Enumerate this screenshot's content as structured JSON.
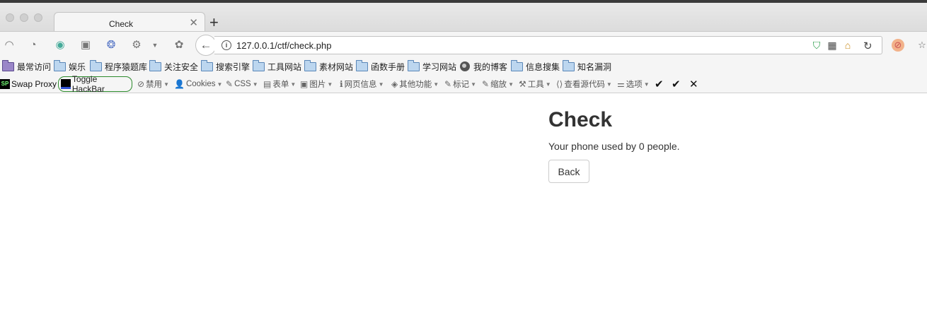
{
  "tab": {
    "title": "Check",
    "close_glyph": "✕",
    "new_tab_glyph": "+"
  },
  "nav": {
    "url": "127.0.0.1/ctf/check.php",
    "back_glyph": "←",
    "reload_glyph": "↻",
    "icons": [
      "rss-icon",
      "history-icon",
      "chrome-icon",
      "reader-icon",
      "bird-icon",
      "gear-icon",
      "palette-icon"
    ]
  },
  "bookmarks": {
    "items": [
      {
        "label": "最常访问",
        "icon": "purple-folder-icon"
      },
      {
        "label": "娱乐",
        "icon": "folder-icon"
      },
      {
        "label": "程序猿题库",
        "icon": "folder-icon"
      },
      {
        "label": "关注安全",
        "icon": "folder-icon"
      },
      {
        "label": "搜索引擎",
        "icon": "folder-icon"
      },
      {
        "label": "工具网站",
        "icon": "folder-icon"
      },
      {
        "label": "素材网站",
        "icon": "folder-icon"
      },
      {
        "label": "函数手册",
        "icon": "folder-icon"
      },
      {
        "label": "学习网站",
        "icon": "folder-icon"
      },
      {
        "label": "我的博客",
        "icon": "globe-icon"
      },
      {
        "label": "信息搜集",
        "icon": "folder-icon"
      },
      {
        "label": "知名漏洞",
        "icon": "folder-icon"
      }
    ]
  },
  "toolbar": {
    "swap_proxy": "Swap Proxy",
    "toggle_hackbar": "Toggle HackBar",
    "menus": [
      {
        "label": "禁用",
        "glyph": "⊘"
      },
      {
        "label": "Cookies",
        "glyph": "👤"
      },
      {
        "label": "CSS",
        "glyph": "✎"
      },
      {
        "label": "表单",
        "glyph": "▤"
      },
      {
        "label": "图片",
        "glyph": "▣"
      },
      {
        "label": "网页信息",
        "glyph": "ℹ"
      },
      {
        "label": "其他功能",
        "glyph": "◈"
      },
      {
        "label": "标记",
        "glyph": "✎"
      },
      {
        "label": "缩放",
        "glyph": "✎"
      },
      {
        "label": "工具",
        "glyph": "⚒"
      },
      {
        "label": "查看源代码",
        "glyph": "⟨⟩"
      },
      {
        "label": "选项",
        "glyph": "⚌"
      }
    ],
    "check1": "✔",
    "check2": "✔",
    "close": "✕"
  },
  "page": {
    "title": "Check",
    "message": "Your phone used by 0 people.",
    "back_label": "Back"
  }
}
